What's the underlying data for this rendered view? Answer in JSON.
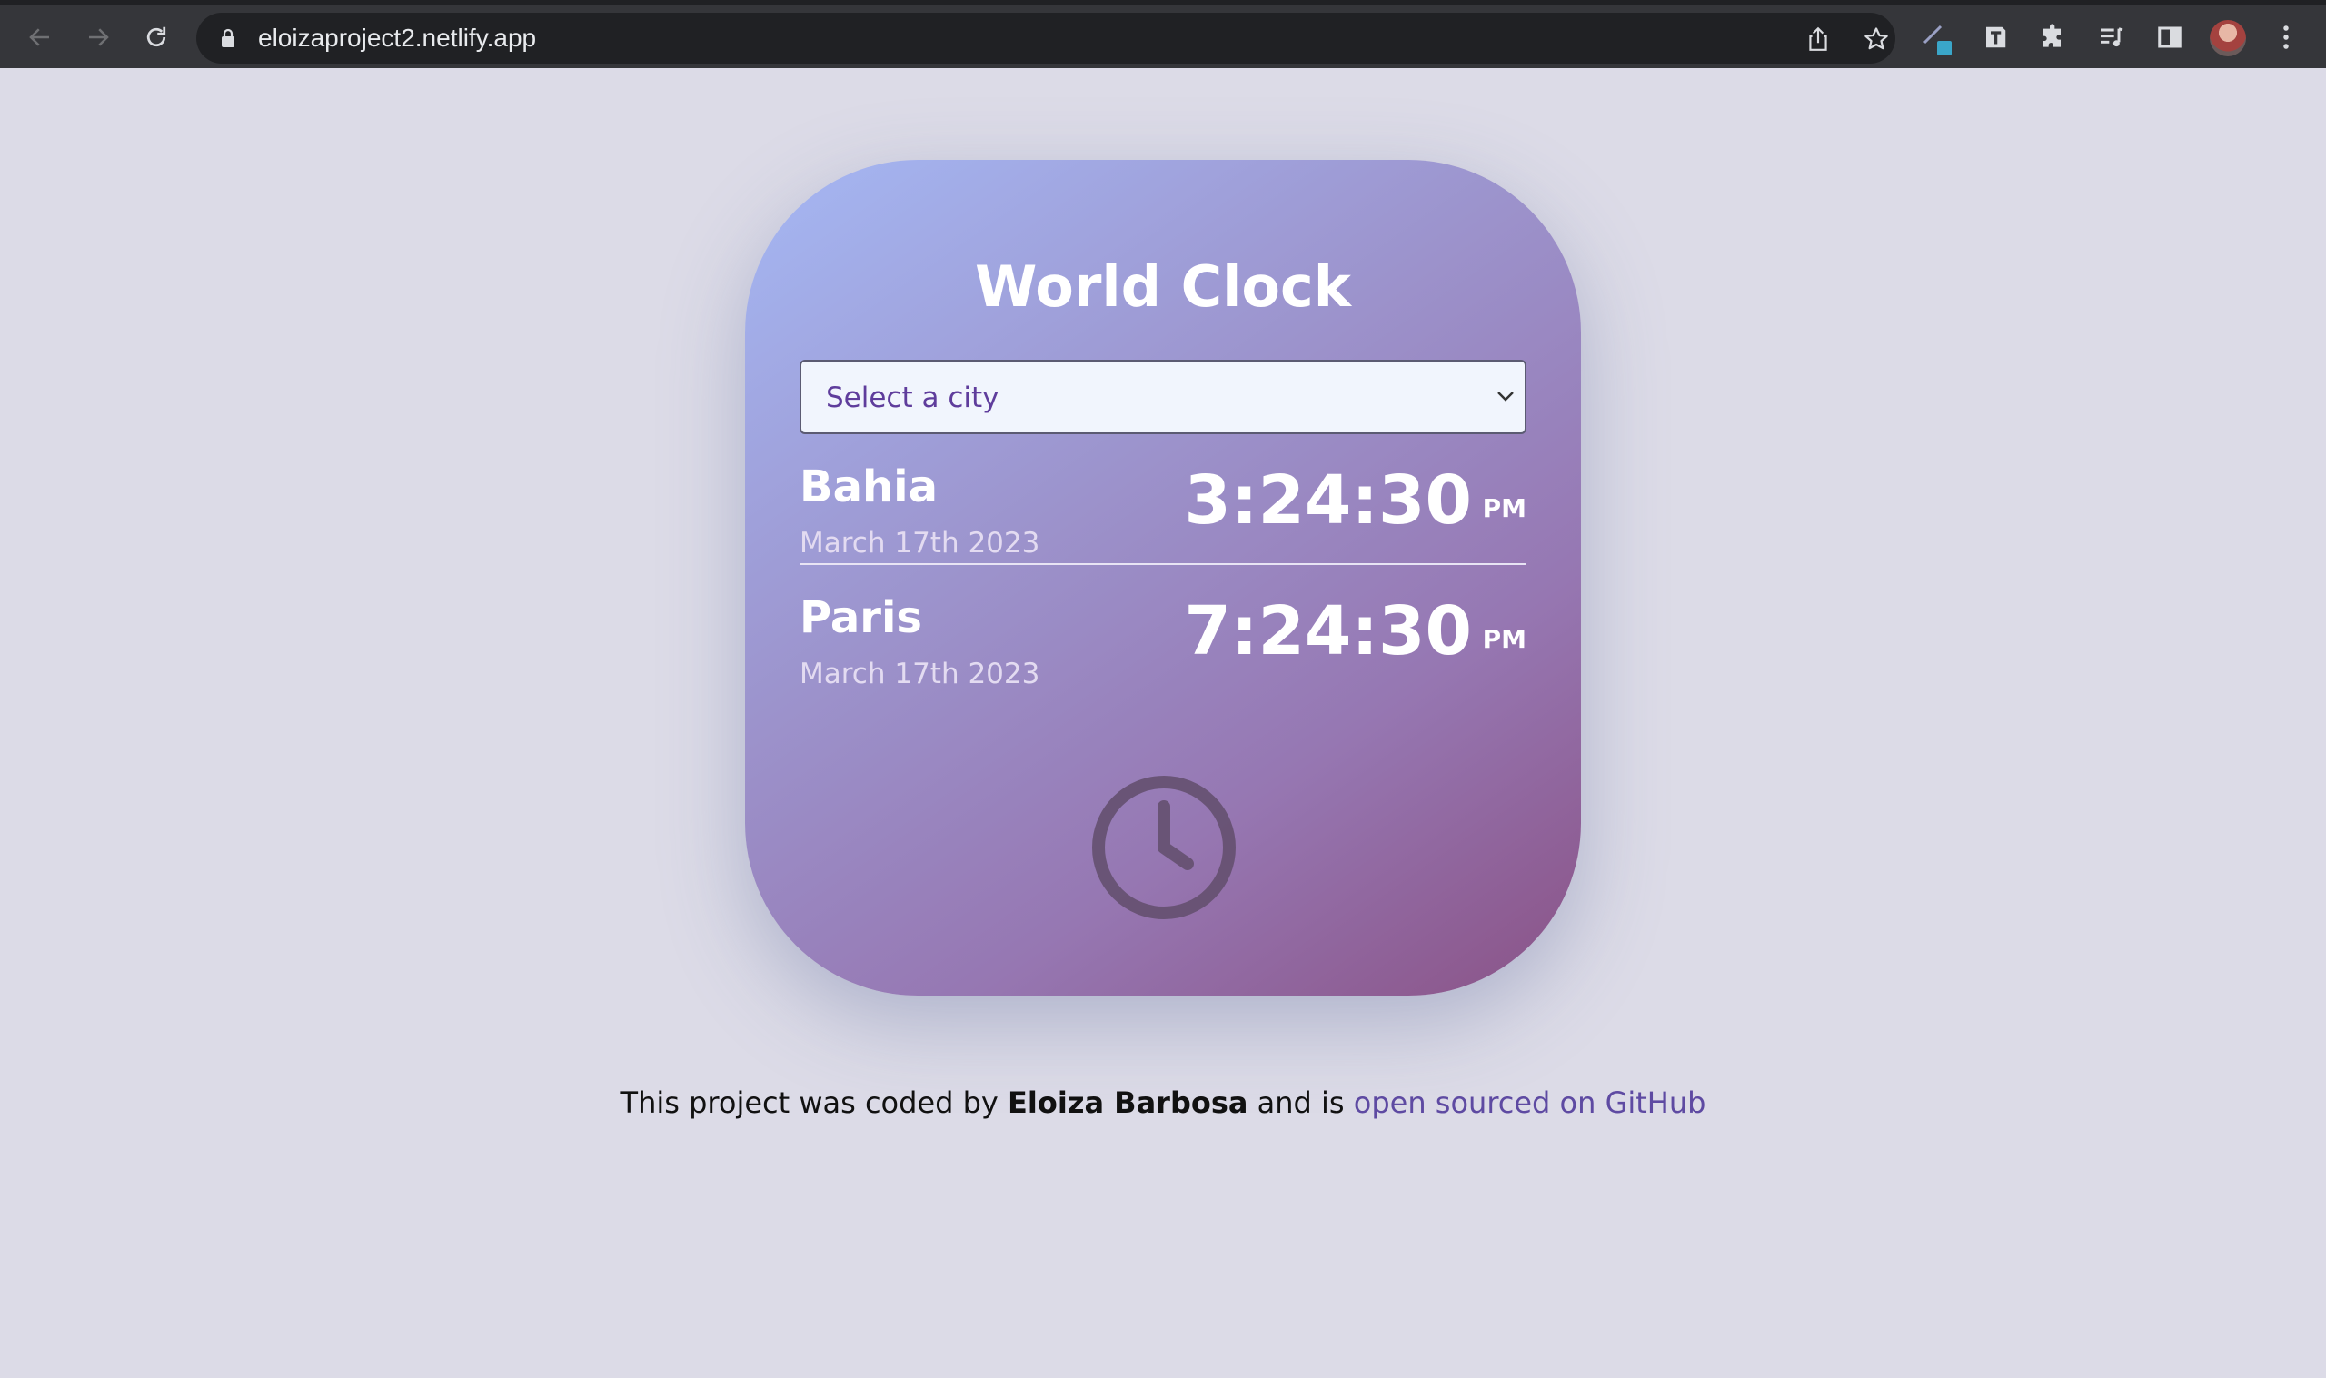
{
  "browser": {
    "url": "eloizaproject2.netlify.app",
    "icons": {
      "back": "arrow-left-icon",
      "forward": "arrow-right-icon",
      "reload": "reload-icon",
      "lock": "lock-icon",
      "share": "share-icon",
      "bookmark": "star-icon",
      "ext_pen": "pen-extension-icon",
      "ext_t": "t-extension-icon",
      "extensions": "puzzle-icon",
      "reading_list": "reading-list-icon",
      "side_panel": "side-panel-icon",
      "profile": "avatar",
      "menu": "kebab-menu-icon"
    }
  },
  "app": {
    "title": "World Clock",
    "select": {
      "selected": "Select a city"
    },
    "cities": [
      {
        "name": "Bahia",
        "date": "March 17th 2023",
        "time": "3:24:30",
        "ampm": "PM"
      },
      {
        "name": "Paris",
        "date": "March 17th 2023",
        "time": "7:24:30",
        "ampm": "PM"
      }
    ],
    "decor_icon": "clock-icon"
  },
  "footer": {
    "prefix": "This project was coded by ",
    "author": "Eloiza Barbosa",
    "middle": " and is ",
    "link_text": "open sourced on GitHub"
  },
  "colors": {
    "page_bg": "#dcdbe7",
    "card_gradient_start": "#a5b8f4",
    "card_gradient_end": "#8a5286",
    "link": "#5e4aa2",
    "chrome_bg": "#35363a"
  }
}
